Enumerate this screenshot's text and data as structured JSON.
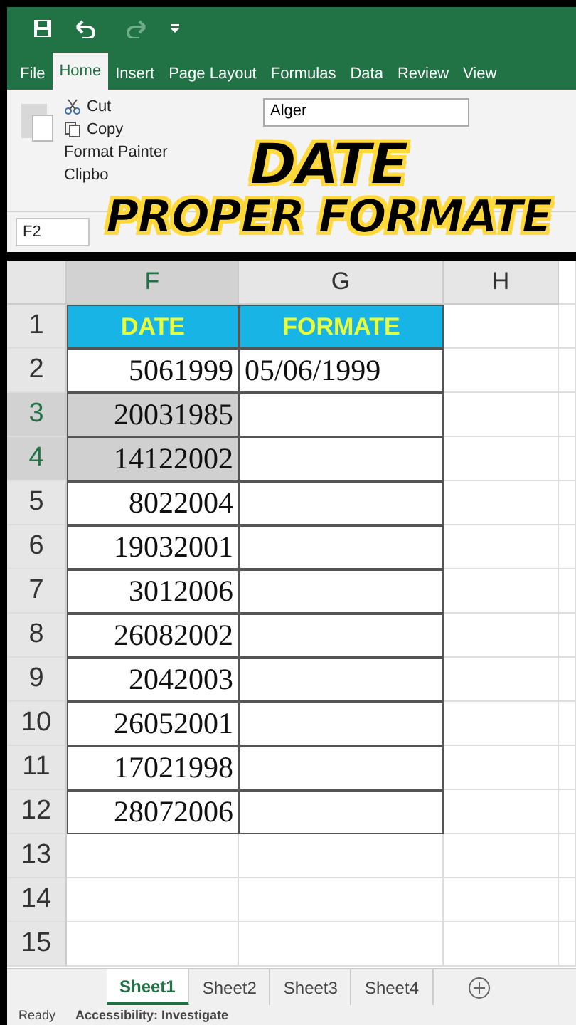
{
  "menu_tabs": [
    {
      "label": "File",
      "selected": false
    },
    {
      "label": "Home",
      "selected": true
    },
    {
      "label": "Insert",
      "selected": false
    },
    {
      "label": "Page Layout",
      "selected": false
    },
    {
      "label": "Formulas",
      "selected": false
    },
    {
      "label": "Data",
      "selected": false
    },
    {
      "label": "Review",
      "selected": false
    },
    {
      "label": "View",
      "selected": false
    }
  ],
  "clipboard": {
    "cut": "Cut",
    "copy": "Copy",
    "format_painter": "Format Painter",
    "group_label": "Clipbo"
  },
  "font_box": {
    "value": "Alger"
  },
  "name_box": {
    "value": "F2"
  },
  "overlay_title": {
    "line_1": "DATE",
    "line_2": "PROPER FORMATE"
  },
  "columns": [
    "F",
    "G",
    "H"
  ],
  "header_row": {
    "number": "1",
    "cells": [
      "DATE",
      "FORMATE"
    ]
  },
  "rows": [
    {
      "number": "2",
      "date": "5061999",
      "formate": "05/06/1999",
      "selected": false
    },
    {
      "number": "3",
      "date": "20031985",
      "selected": true
    },
    {
      "number": "4",
      "date": "14122002",
      "selected": true
    },
    {
      "number": "5",
      "date": "8022004",
      "selected": false
    },
    {
      "number": "6",
      "date": "19032001",
      "selected": false
    },
    {
      "number": "7",
      "date": "3012006",
      "selected": false
    },
    {
      "number": "8",
      "date": "26082002",
      "selected": false
    },
    {
      "number": "9",
      "date": "2042003",
      "selected": false
    },
    {
      "number": "10",
      "date": "26052001",
      "selected": false
    },
    {
      "number": "11",
      "date": "17021998",
      "selected": false
    },
    {
      "number": "12",
      "date": "28072006",
      "selected": false
    }
  ],
  "empty_rows": [
    "13",
    "14",
    "15"
  ],
  "sheet_tabs": [
    {
      "label": "Sheet1",
      "selected": true
    },
    {
      "label": "Sheet2",
      "selected": false
    },
    {
      "label": "Sheet3",
      "selected": false
    },
    {
      "label": "Sheet4",
      "selected": false
    }
  ],
  "status_bar": {
    "state": "Ready",
    "accessibility": "Accessibility: Investigate"
  }
}
